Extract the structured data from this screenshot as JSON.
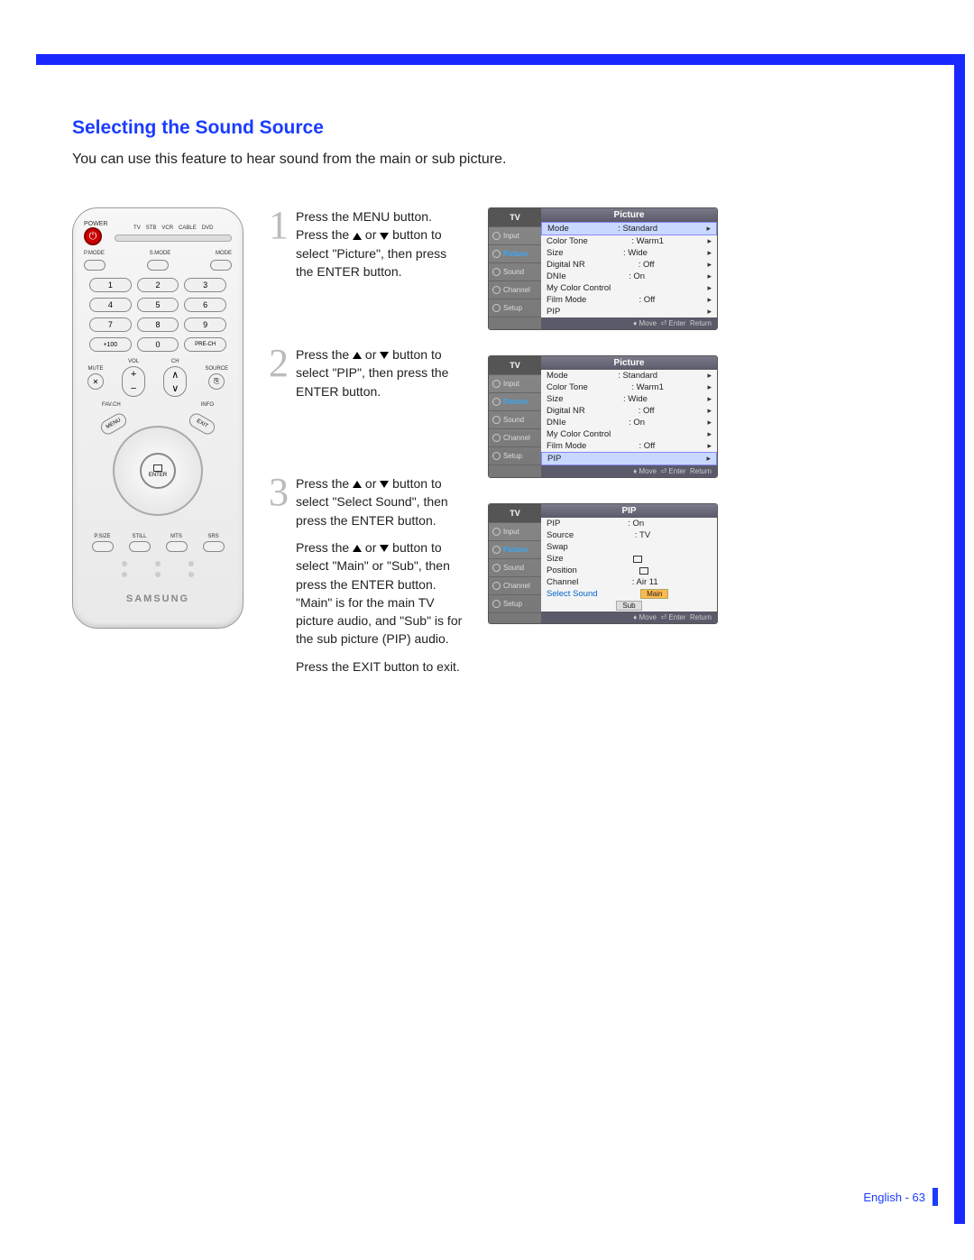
{
  "page": {
    "title": "Selecting the Sound Source",
    "intro": "You can use this feature to hear sound from the main or sub picture.",
    "footer": "English - 63"
  },
  "remote": {
    "power_label": "POWER",
    "devices": [
      "TV",
      "STB",
      "VCR",
      "CABLE",
      "DVD"
    ],
    "mode_labels": [
      "P.MODE",
      "S.MODE",
      "MODE"
    ],
    "keypad": [
      "1",
      "2",
      "3",
      "4",
      "5",
      "6",
      "7",
      "8",
      "9",
      "+100",
      "0",
      "PRE-CH"
    ],
    "vol_label": "VOL",
    "ch_label": "CH",
    "mute_label": "MUTE",
    "source_label": "SOURCE",
    "favch_label": "FAV.CH",
    "info_label": "INFO",
    "menu_label": "MENU",
    "exit_label": "EXIT",
    "enter_label": "ENTER",
    "bottom_labels": [
      "P.SIZE",
      "STILL",
      "MTS",
      "SRS"
    ],
    "brand": "SAMSUNG"
  },
  "steps": {
    "s1_num": "1",
    "s1_a": "Press the MENU button.",
    "s1_b_pre": "Press the ",
    "s1_b_post": " button to select \"Picture\", then press the ENTER button.",
    "s2_num": "2",
    "s2_pre": "Press the ",
    "s2_post": " button to select \"PIP\", then press the ENTER button.",
    "s3_num": "3",
    "s3_a_pre": "Press the ",
    "s3_a_post": " button to select \"Select Sound\", then press the ENTER button.",
    "s3_b_pre": "Press the ",
    "s3_b_post": " button to select \"Main\" or \"Sub\", then press the ENTER button. \"Main\" is for the main TV picture audio, and \"Sub\" is for the sub picture (PIP) audio.",
    "s3_c": "Press the EXIT button to exit.",
    "or": " or "
  },
  "osd": {
    "tv_label": "TV",
    "side": [
      "Input",
      "Picture",
      "Sound",
      "Channel",
      "Setup"
    ],
    "foot_move": "Move",
    "foot_enter": "Enter",
    "foot_return": "Return",
    "picture_title": "Picture",
    "pip_title": "PIP",
    "picture_rows": [
      {
        "k": "Mode",
        "v": ": Standard"
      },
      {
        "k": "Color Tone",
        "v": ": Warm1"
      },
      {
        "k": "Size",
        "v": ": Wide"
      },
      {
        "k": "Digital NR",
        "v": ": Off"
      },
      {
        "k": "DNIe",
        "v": ": On"
      },
      {
        "k": "My Color Control",
        "v": ""
      },
      {
        "k": "Film Mode",
        "v": ": Off"
      },
      {
        "k": "PIP",
        "v": ""
      }
    ],
    "pip_rows": [
      {
        "k": "PIP",
        "v": ": On"
      },
      {
        "k": "Source",
        "v": ": TV"
      },
      {
        "k": "Swap",
        "v": ""
      },
      {
        "k": "Size",
        "v": "icon"
      },
      {
        "k": "Position",
        "v": "icon"
      },
      {
        "k": "Channel",
        "v": ": Air 11"
      }
    ],
    "select_sound": "Select Sound",
    "main": "Main",
    "sub": "Sub"
  }
}
